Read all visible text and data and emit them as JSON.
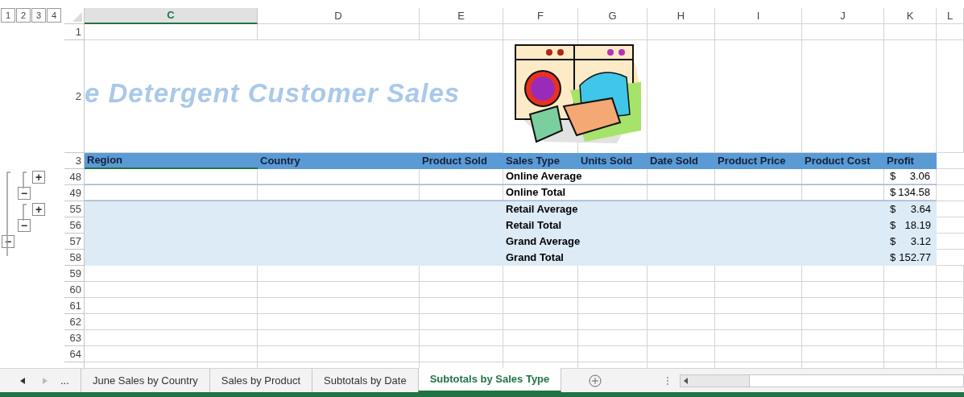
{
  "outline_levels": [
    "1",
    "2",
    "3",
    "4"
  ],
  "columns": [
    {
      "letter": "C",
      "selected": true
    },
    {
      "letter": "D",
      "selected": false
    },
    {
      "letter": "E",
      "selected": false
    },
    {
      "letter": "F",
      "selected": false
    },
    {
      "letter": "G",
      "selected": false
    },
    {
      "letter": "H",
      "selected": false
    },
    {
      "letter": "I",
      "selected": false
    },
    {
      "letter": "J",
      "selected": false
    },
    {
      "letter": "K",
      "selected": false
    },
    {
      "letter": "L",
      "selected": false
    }
  ],
  "title": "e Detergent Customer Sales",
  "rows": [
    {
      "number": "1",
      "kind": "blank"
    },
    {
      "number": "2",
      "kind": "banner"
    },
    {
      "number": "3",
      "kind": "header",
      "labels": [
        "Region",
        "Country",
        "Product Sold",
        "Sales Type",
        "Units  Sold",
        "Date  Sold",
        "Product Price",
        "Product Cost",
        "Profit"
      ]
    },
    {
      "number": "48",
      "kind": "subtotal",
      "shaded": false,
      "sales_type": "Online Average",
      "currency": "$",
      "amount": "3.06",
      "outline": {
        "symbol": "+",
        "kind": "inner"
      }
    },
    {
      "number": "49",
      "kind": "subtotal",
      "shaded": false,
      "sales_type": "Online Total",
      "currency": "$",
      "amount": "134.58",
      "outline": {
        "symbol": "−",
        "kind": "middle"
      }
    },
    {
      "number": "55",
      "kind": "subtotal",
      "shaded": true,
      "sales_type": "Retail Average",
      "currency": "$",
      "amount": "3.64",
      "outline": {
        "symbol": "+",
        "kind": "inner"
      }
    },
    {
      "number": "56",
      "kind": "subtotal",
      "shaded": true,
      "sales_type": "Retail Total",
      "currency": "$",
      "amount": "18.19",
      "outline": {
        "symbol": "−",
        "kind": "middle"
      }
    },
    {
      "number": "57",
      "kind": "subtotal",
      "shaded": true,
      "sales_type": "Grand Average",
      "currency": "$",
      "amount": "3.12",
      "outline": {
        "symbol": "−",
        "kind": "outer"
      }
    },
    {
      "number": "58",
      "kind": "subtotal",
      "shaded": true,
      "sales_type": "Grand Total",
      "currency": "$",
      "amount": "152.77"
    },
    {
      "number": "59",
      "kind": "blank"
    },
    {
      "number": "60",
      "kind": "blank"
    },
    {
      "number": "61",
      "kind": "blank"
    },
    {
      "number": "62",
      "kind": "blank"
    },
    {
      "number": "63",
      "kind": "blank"
    },
    {
      "number": "64",
      "kind": "blank"
    }
  ],
  "sheet_nav": {
    "more": "..."
  },
  "sheet_tabs": [
    {
      "label": "June Sales by Country",
      "selected": false
    },
    {
      "label": "Sales by Product",
      "selected": false
    },
    {
      "label": "Subtotals by Date",
      "selected": false
    },
    {
      "label": "Subtotals by Sales Type",
      "selected": true
    }
  ]
}
